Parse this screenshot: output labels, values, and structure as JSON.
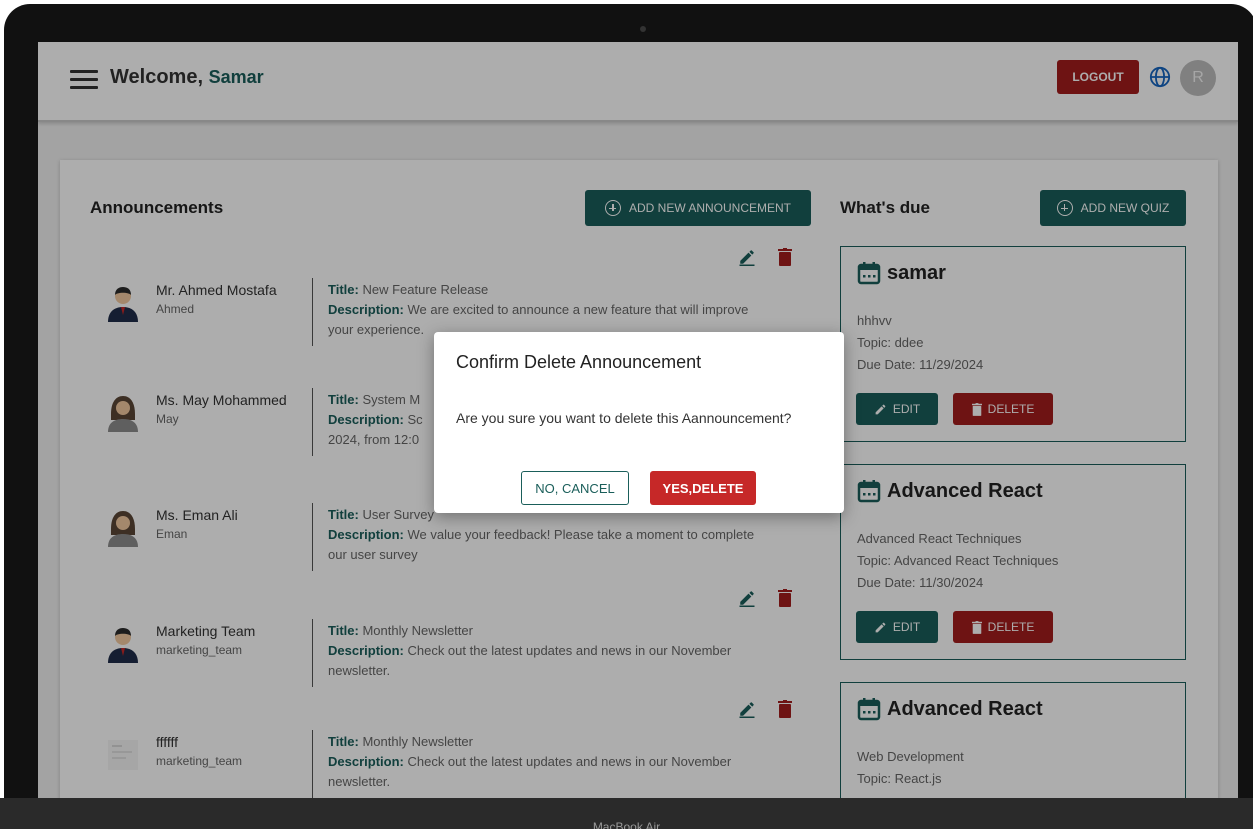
{
  "header": {
    "welcome_label": "Welcome,",
    "username": "Samar",
    "logout_label": "LOGOUT",
    "avatar_letter": "R"
  },
  "announcements": {
    "title": "Announcements",
    "add_button_label": "ADD NEW ANNOUNCEMENT",
    "items": [
      {
        "name": "Mr. Ahmed Mostafa",
        "username": "Ahmed",
        "title_label": "Title:",
        "title": "New Feature Release",
        "desc_label": "Description:",
        "description": "We are excited to announce a new feature that will improve your experience."
      },
      {
        "name": "Ms. May Mohammed",
        "username": "May",
        "title_label": "Title:",
        "title": "System M",
        "desc_label": "Description:",
        "description": "Sc",
        "description_line2": "2024, from 12:0"
      },
      {
        "name": "Ms. Eman Ali",
        "username": "Eman",
        "title_label": "Title:",
        "title": "User Survey",
        "desc_label": "Description:",
        "description": "We value your feedback! Please take a moment to complete our user survey"
      },
      {
        "name": "Marketing Team",
        "username": "marketing_team",
        "title_label": "Title:",
        "title": "Monthly Newsletter",
        "desc_label": "Description:",
        "description": "Check out the latest updates and news in our November newsletter."
      },
      {
        "name": "ffffff",
        "username": "marketing_team",
        "title_label": "Title:",
        "title": "Monthly Newsletter",
        "desc_label": "Description:",
        "description": "Check out the latest updates and news in our November newsletter."
      }
    ]
  },
  "whats_due": {
    "title": "What's due",
    "add_button_label": "ADD NEW QUIZ",
    "edit_label": "EDIT",
    "delete_label": "DELETE",
    "items": [
      {
        "title": "samar",
        "description": "hhhvv",
        "topic": "Topic: ddee",
        "due_date": "Due Date: 11/29/2024"
      },
      {
        "title": "Advanced React",
        "description": "Advanced React Techniques",
        "topic": "Topic: Advanced React Techniques",
        "due_date": "Due Date: 11/30/2024"
      },
      {
        "title": "Advanced React",
        "description": "Web Development",
        "topic": "Topic: React.js",
        "due_date": ""
      }
    ]
  },
  "dialog": {
    "title": "Confirm Delete Announcement",
    "message": "Are you sure you want to delete this Aannouncement?",
    "cancel_label": "NO, CANCEL",
    "confirm_label": "YES,DELETE"
  },
  "device": {
    "label": "MacBook Air"
  },
  "colors": {
    "primary": "#1a5e5a",
    "danger": "#a31d1d",
    "confirm": "#c62828"
  }
}
